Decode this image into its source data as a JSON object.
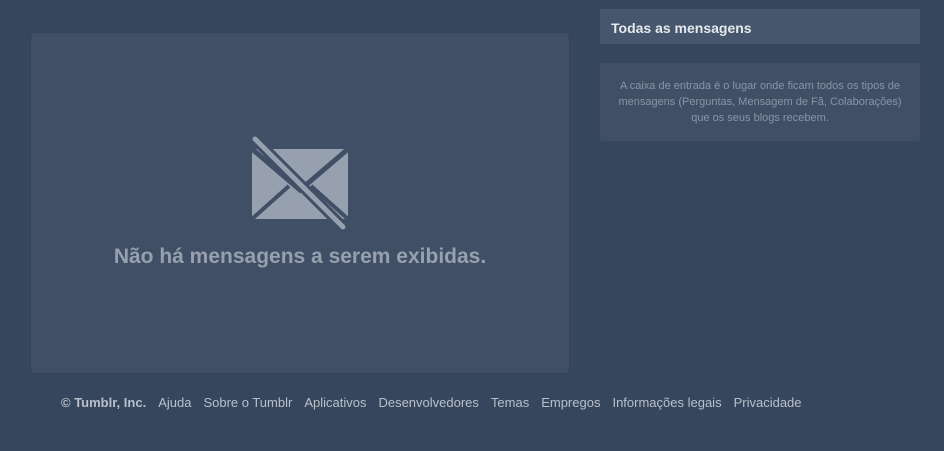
{
  "main": {
    "empty_icon": "crossed-out-envelope-icon",
    "empty_message": "Não há mensagens a serem exibidas."
  },
  "sidebar": {
    "header": "Todas as mensagens",
    "info": "A caixa de entrada é o lugar onde ficam todos os tipos de mensagens (Perguntas, Mensagem de Fã, Colaborações) que os seus blogs recebem."
  },
  "footer": {
    "copyright": "© Tumblr, Inc.",
    "links": [
      {
        "label": "Ajuda"
      },
      {
        "label": "Sobre o Tumblr"
      },
      {
        "label": "Aplicativos"
      },
      {
        "label": "Desenvolvedores"
      },
      {
        "label": "Temas"
      },
      {
        "label": "Empregos"
      },
      {
        "label": "Informações legais"
      },
      {
        "label": "Privacidade"
      }
    ]
  },
  "colors": {
    "background": "#36465d",
    "panel": "#404f66",
    "muted_text": "#97a0ae"
  }
}
